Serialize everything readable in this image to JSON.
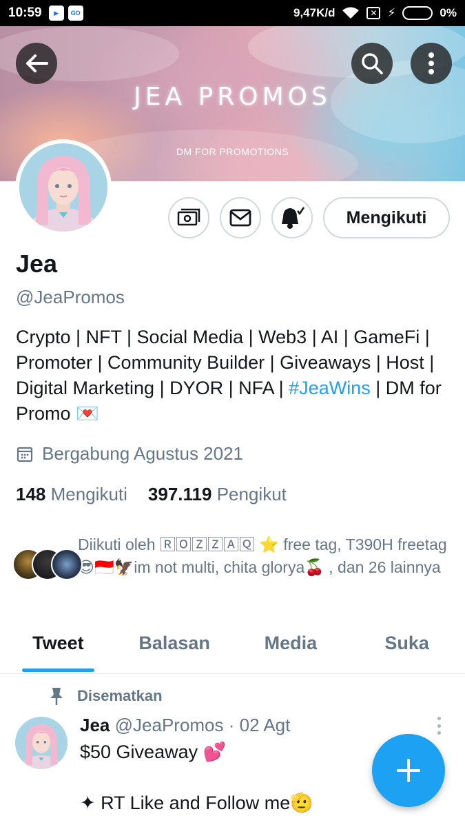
{
  "status_bar": {
    "time": "10:59",
    "speed": "9,47K/d",
    "battery": "0%"
  },
  "banner": {
    "title": "JEA PROMOS",
    "subtitle": "DM FOR PROMOTIONS"
  },
  "profile": {
    "name": "Jea",
    "handle": "@JeaPromos",
    "follow_button": "Mengikuti",
    "bio_before": "Crypto | NFT | Social Media | Web3 | AI | GameFi | Promoter | Community Builder | Giveaways | Host | Digital Marketing | DYOR | NFA | ",
    "bio_hashtag": "#JeaWins",
    "bio_after": " | DM for Promo 💌",
    "joined": "Bergabung Agustus 2021",
    "following_count": "148",
    "following_label": "Mengikuti",
    "followers_count": "397.119",
    "followers_label": "Pengikut",
    "followed_by": "Diikuti oleh 🅁🄾🅉🅉🄰🅀 ⭐ free tag, T390H freetag😎🇮🇩🦅im not multi, chita glorya🍒 , dan 26 lainnya"
  },
  "tabs": [
    {
      "label": "Tweet"
    },
    {
      "label": "Balasan"
    },
    {
      "label": "Media"
    },
    {
      "label": "Suka"
    }
  ],
  "tweet": {
    "pinned_label": "Disematkan",
    "author_name": "Jea",
    "author_meta": "@JeaPromos · 02 Agt",
    "text": "$50 Giveaway 💕\n\n✦ RT Like and Follow me🫡"
  },
  "icons": {
    "back": "arrow-left-icon",
    "search": "search-icon",
    "more": "more-vertical-icon",
    "tip": "money-icon",
    "message": "envelope-icon",
    "notifications": "bell-check-icon",
    "calendar": "calendar-icon",
    "pin": "pin-icon",
    "compose": "plus-icon"
  },
  "colors": {
    "accent": "#1da1f2",
    "secondary_text": "#657786"
  }
}
